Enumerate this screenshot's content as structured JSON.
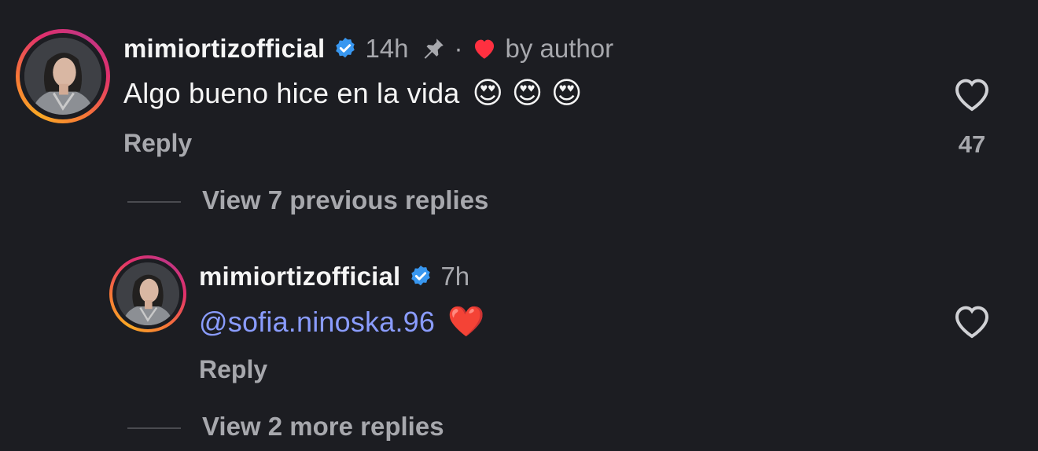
{
  "comments": [
    {
      "username": "mimiortizofficial",
      "verified_icon": "verified-badge-icon",
      "time": "14h",
      "pinned_icon": "pin-icon",
      "separator": "·",
      "liked_by_author_icon": "heart-filled-icon",
      "liked_by_author_label": "by author",
      "text": "Algo bueno hice en la vida",
      "emojis": "😍 😍 😍",
      "reply_label": "Reply",
      "like_icon": "heart-outline-icon",
      "like_count": "47",
      "view_replies_label": "View 7 previous replies"
    },
    {
      "username": "mimiortizofficial",
      "verified_icon": "verified-badge-icon",
      "time": "7h",
      "mention": "@sofia.ninoska.96",
      "emoji": "❤️",
      "reply_label": "Reply",
      "like_icon": "heart-outline-icon",
      "view_replies_label": "View 2 more replies"
    }
  ],
  "colors": {
    "background": "#1c1d22",
    "primary_text": "#f5f5f5",
    "secondary_text": "#a7a8ad",
    "mention": "#8a9cff",
    "verified": "#3897f0",
    "author_heart": "#ff3040"
  }
}
